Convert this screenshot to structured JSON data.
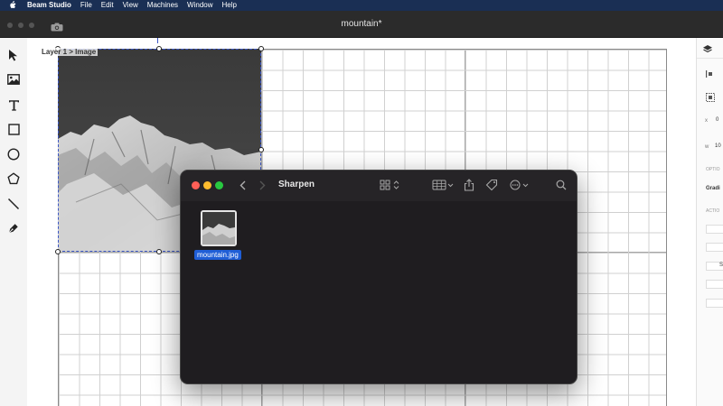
{
  "menubar": {
    "app_name": "Beam Studio",
    "items": [
      "File",
      "Edit",
      "View",
      "Machines",
      "Window",
      "Help"
    ]
  },
  "window": {
    "title": "mountain*"
  },
  "left_toolbar": {
    "tools": [
      "cursor-icon",
      "image-icon",
      "text-icon",
      "rectangle-icon",
      "ellipse-icon",
      "polygon-icon",
      "line-icon",
      "pen-icon"
    ]
  },
  "canvas": {
    "layer_label": "Layer 1 > Image"
  },
  "right_panel": {
    "x_label": "x",
    "x_value": "0",
    "w_label": "w",
    "w_value": "10",
    "options_heading": "OPTIO",
    "gradient_label": "Gradi",
    "actions_heading": "ACTIO",
    "button_s": "S"
  },
  "finder": {
    "title": "Sharpen",
    "files": [
      {
        "name": "mountain.jpg",
        "selected": true
      }
    ]
  },
  "colors": {
    "menubar_bg": "#1a2f54",
    "titlebar_bg": "#2b2b2b",
    "finder_bg": "#1f1d20",
    "selection_blue": "#1f5ed6",
    "traffic_red": "#ff5f57",
    "traffic_yellow": "#febc2e",
    "traffic_green": "#28c840"
  }
}
